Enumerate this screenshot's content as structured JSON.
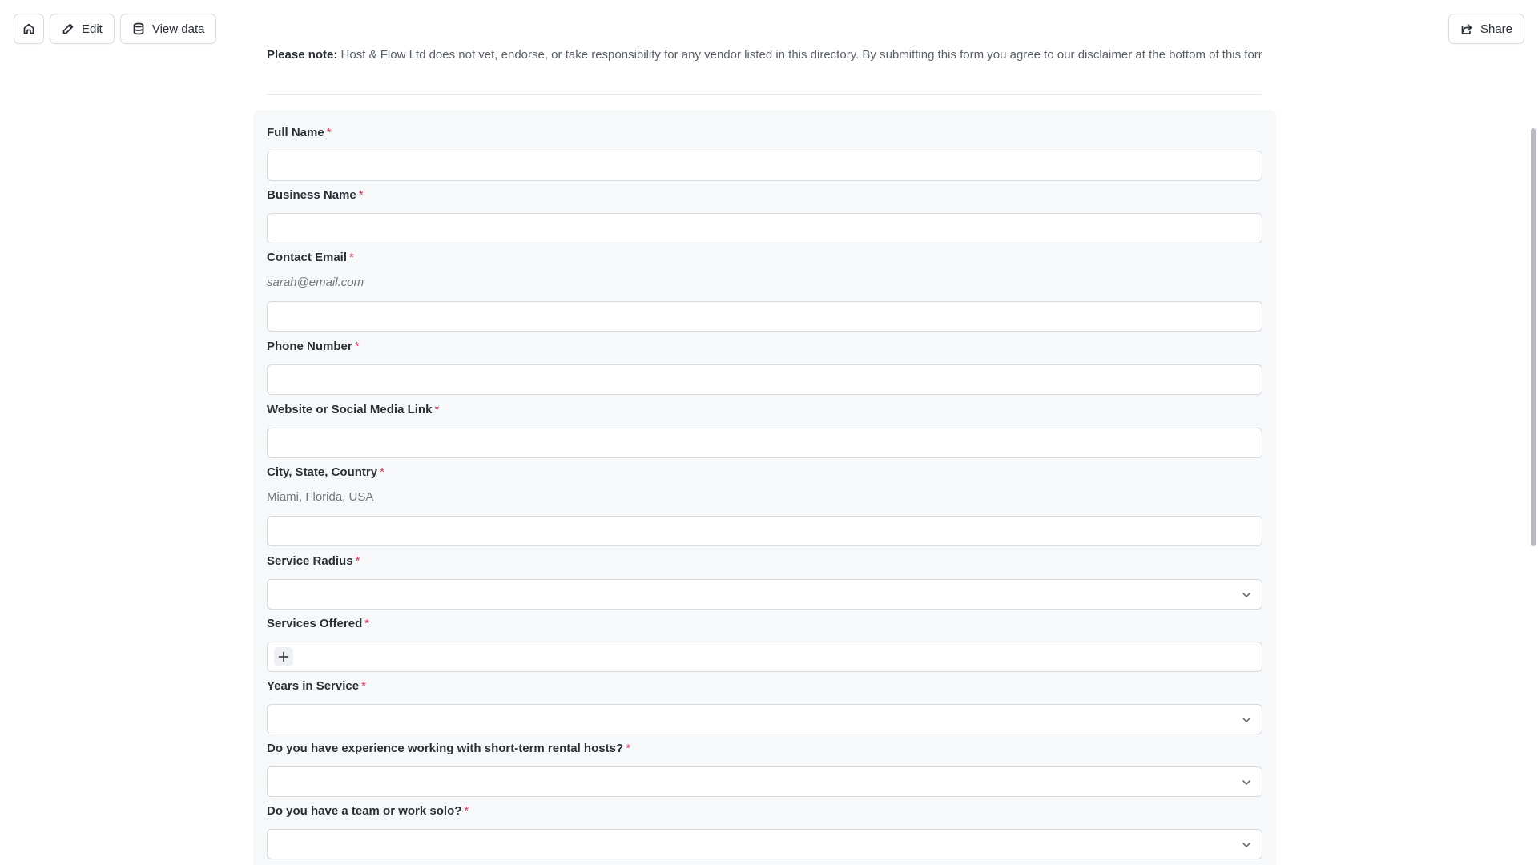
{
  "toolbar": {
    "edit_label": "Edit",
    "view_data_label": "View data",
    "share_label": "Share"
  },
  "notice": {
    "prefix": "Please note:",
    "text": "Host & Flow Ltd does not vet, endorse, or take responsibility for any vendor listed in this directory. By submitting this form you agree to our disclaimer at the bottom of this form."
  },
  "required_marker": "*",
  "fields": {
    "full_name": {
      "label": "Full Name"
    },
    "business_name": {
      "label": "Business Name"
    },
    "contact_email": {
      "label": "Contact Email",
      "hint": "sarah@email.com"
    },
    "phone_number": {
      "label": "Phone Number"
    },
    "website": {
      "label": "Website or Social Media Link"
    },
    "location": {
      "label": "City, State, Country",
      "hint": "Miami, Florida, USA"
    },
    "service_radius": {
      "label": "Service Radius"
    },
    "services_offered": {
      "label": "Services Offered"
    },
    "years_in_service": {
      "label": "Years in Service"
    },
    "str_experience": {
      "label": "Do you have experience working with short-term rental hosts?"
    },
    "team_or_solo": {
      "label": "Do you have a team or work solo?"
    }
  },
  "icons": {
    "home": "home-icon",
    "edit": "pencil-icon",
    "view_data": "database-icon",
    "share": "share-icon",
    "dropdown": "chevron-down-icon",
    "add": "plus-icon"
  },
  "colors": {
    "required": "#d4365b",
    "panel_bg": "#f7f8fa",
    "border": "#d6d9de"
  }
}
